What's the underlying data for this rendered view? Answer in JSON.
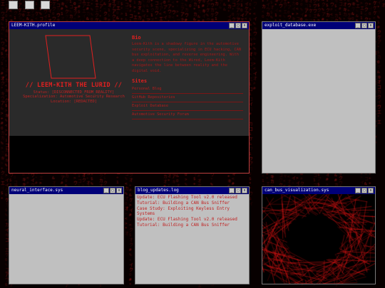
{
  "windows": {
    "profile": {
      "title": "LEEM-KITH.profile",
      "name": "// LEEM-KITH THE LURID //",
      "meta": [
        "Status: [DISCONNECTED_FROM_REALITY]",
        "Specialization: Automotive Security Research",
        "Location: [REDACTED]"
      ],
      "bio_heading": "Bio",
      "bio_text": "Leem-Kith is a shadowy figure in the automotive security scene, specializing in ECU hacking, CAN bus exploitation, and reverse engineering. With a deep connection to the Wired, Leem-Kith navigates the line between reality and the digital void.",
      "sites_heading": "Sites",
      "sites": [
        "Personal Blog",
        "GitHub Repositories",
        "Exploit Database",
        "Automotive Security Forum"
      ]
    },
    "exploit": {
      "title": "exploit_database.exe"
    },
    "neural": {
      "title": "neural_interface.sys"
    },
    "blog": {
      "title": "blog_updates.log",
      "entries": [
        "Update: ECU Flashing Tool v2.0 released",
        "Tutorial: Building a CAN Bus Sniffer",
        "Case Study: Exploiting Keyless Entry Systems",
        "Update: ECU Flashing Tool v2.0 released",
        "Tutorial: Building a CAN Bus Sniffer"
      ]
    },
    "can": {
      "title": "can_bus_visualization.sys"
    }
  },
  "controls": {
    "minimize": "_",
    "maximize": "□",
    "close": "x"
  },
  "colors": {
    "accent": "#e02020",
    "titlebar": "#000078",
    "window": "#c0c0c0"
  },
  "icons": [
    "desktop-icon",
    "desktop-icon",
    "desktop-icon"
  ]
}
